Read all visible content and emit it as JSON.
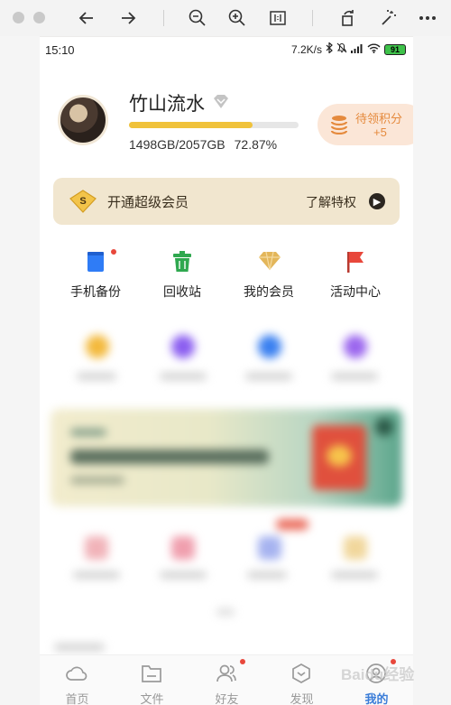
{
  "status_bar": {
    "time": "15:10",
    "network_speed": "7.2K/s",
    "battery": "91"
  },
  "profile": {
    "username": "竹山流水",
    "storage_used": "1498GB/2057GB",
    "storage_percent": "72.87%",
    "storage_fraction": 0.7287
  },
  "points_card": {
    "label": "待领积分",
    "value": "+5"
  },
  "vip_banner": {
    "label": "开通超级会员",
    "link_label": "了解特权"
  },
  "menu": {
    "items": [
      {
        "label": "手机备份",
        "icon": "phone-backup-icon",
        "color": "#2f7cf6",
        "has_dot": true
      },
      {
        "label": "回收站",
        "icon": "trash-icon",
        "color": "#2fa84f",
        "has_dot": false
      },
      {
        "label": "我的会员",
        "icon": "diamond-icon",
        "color": "#e3b65a",
        "has_dot": false
      },
      {
        "label": "活动中心",
        "icon": "flag-icon",
        "color": "#e8473b",
        "has_dot": false
      }
    ]
  },
  "tabbar": {
    "items": [
      {
        "label": "首页",
        "icon": "cloud-icon",
        "active": false,
        "has_dot": false
      },
      {
        "label": "文件",
        "icon": "folder-icon",
        "active": false,
        "has_dot": false
      },
      {
        "label": "好友",
        "icon": "friends-icon",
        "active": false,
        "has_dot": true
      },
      {
        "label": "发现",
        "icon": "discover-icon",
        "active": false,
        "has_dot": false
      },
      {
        "label": "我的",
        "icon": "profile-icon",
        "active": true,
        "has_dot": true
      }
    ]
  },
  "colors": {
    "accent": "#3b7dd8",
    "progress": "#f0c23a",
    "points": "#e58a3d",
    "notification": "#e8473b"
  }
}
